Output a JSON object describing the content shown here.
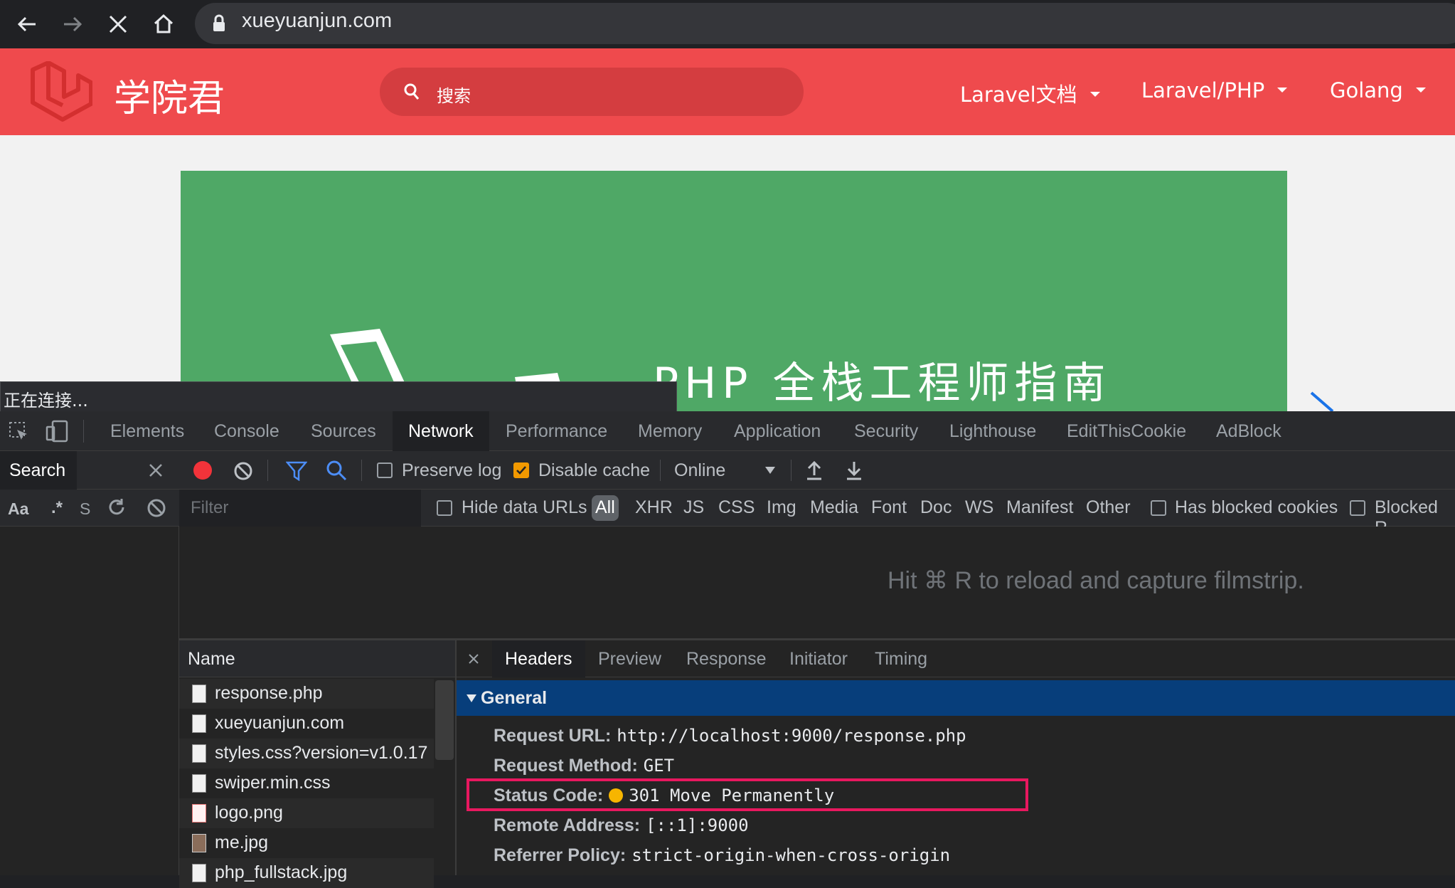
{
  "browser": {
    "url": "xueyuanjun.com"
  },
  "site": {
    "title": "学院君",
    "search_placeholder": "搜索",
    "nav": [
      "Laravel文档",
      "Laravel/PHP",
      "Golang"
    ],
    "banner_text": "PHP 全栈工程师指南",
    "status_text": "正在连接..."
  },
  "devtools": {
    "tabs": [
      "Elements",
      "Console",
      "Sources",
      "Network",
      "Performance",
      "Memory",
      "Application",
      "Security",
      "Lighthouse",
      "EditThisCookie",
      "AdBlock"
    ],
    "active_tab": "Network",
    "search_panel": {
      "title": "Search",
      "aa": "Aa",
      "regex": ".*",
      "partial": "S"
    },
    "toolbar": {
      "preserve_log": "Preserve log",
      "disable_cache": "Disable cache",
      "throttle": "Online"
    },
    "filter": {
      "placeholder": "Filter",
      "hide_data_urls": "Hide data URLs",
      "types": [
        "All",
        "XHR",
        "JS",
        "CSS",
        "Img",
        "Media",
        "Font",
        "Doc",
        "WS",
        "Manifest",
        "Other"
      ],
      "has_blocked_cookies": "Has blocked cookies",
      "blocked_requests": "Blocked R"
    },
    "filmstrip_hint": "Hit ⌘ R to reload and capture filmstrip.",
    "name_header": "Name",
    "files": [
      "response.php",
      "xueyuanjun.com",
      "styles.css?version=v1.0.17",
      "swiper.min.css",
      "logo.png",
      "me.jpg",
      "php_fullstack.jpg"
    ],
    "detail_tabs": [
      "Headers",
      "Preview",
      "Response",
      "Initiator",
      "Timing"
    ],
    "general": {
      "title": "General",
      "request_url_label": "Request URL:",
      "request_url": "http://localhost:9000/response.php",
      "request_method_label": "Request Method:",
      "request_method": "GET",
      "status_code_label": "Status Code:",
      "status_code": "301 Move Permanently",
      "remote_address_label": "Remote Address:",
      "remote_address": "[::1]:9000",
      "referrer_policy_label": "Referrer Policy:",
      "referrer_policy": "strict-origin-when-cross-origin"
    }
  },
  "colors": {
    "site_red": "#ef4a4d",
    "banner_green": "#4fa866",
    "highlight": "#e8185f",
    "general_bar": "#073e7b"
  }
}
